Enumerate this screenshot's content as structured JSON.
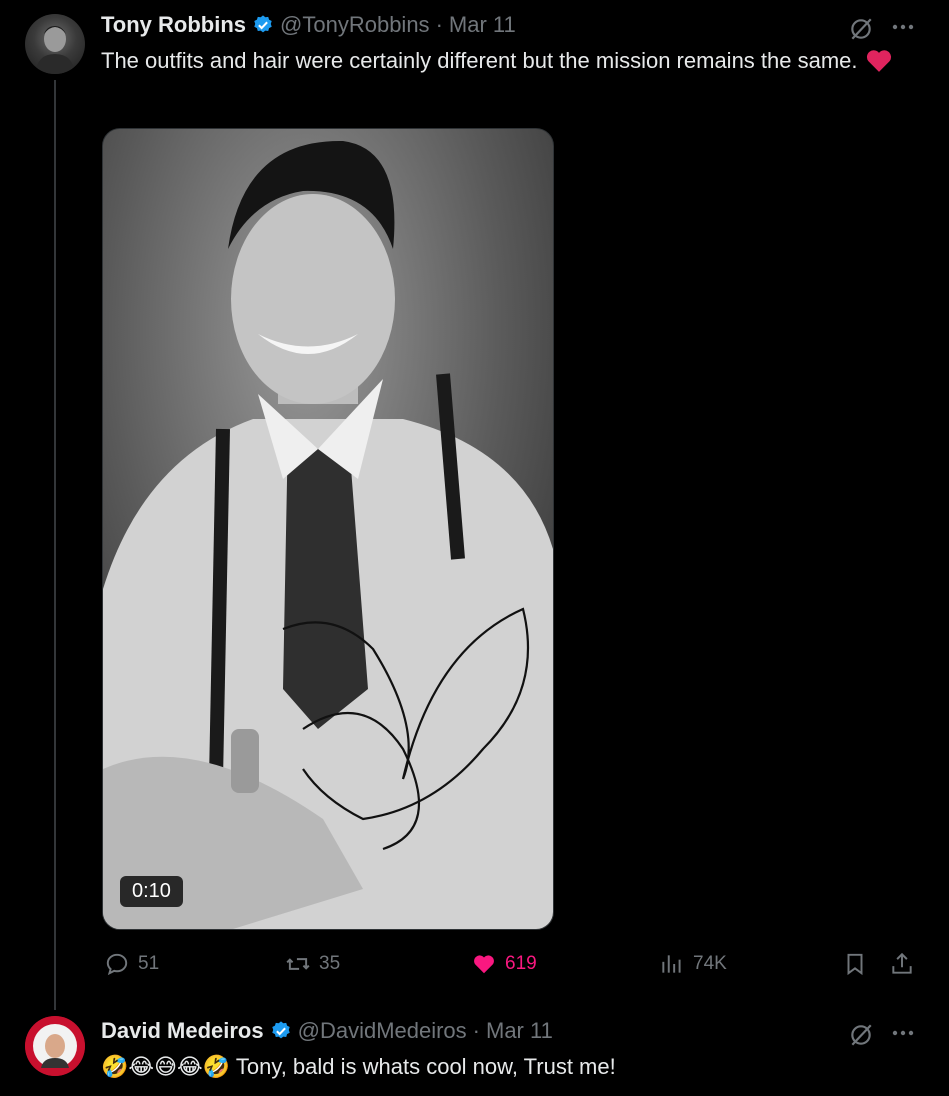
{
  "tweet": {
    "author_name": "Tony Robbins",
    "author_handle": "@TonyRobbins",
    "separator": "·",
    "date": "Mar 11",
    "text": "The outfits and hair were certainly different but the mission remains the same.",
    "video_duration": "0:10",
    "actions": {
      "replies": "51",
      "reposts": "35",
      "likes": "619",
      "views": "74K"
    },
    "liked": true,
    "icons": [
      "grok-icon",
      "more-icon",
      "reply-icon",
      "repost-icon",
      "heart-icon",
      "views-icon",
      "bookmark-icon",
      "share-icon",
      "verified-badge-icon"
    ],
    "colors": {
      "like": "#f91880",
      "verified": "#1d9bf0",
      "muted": "#71767b"
    }
  },
  "reply": {
    "author_name": "David Medeiros",
    "author_handle": "@DavidMedeiros",
    "separator": "·",
    "date": "Mar 11",
    "emojis": "🤣😂😅😂🤣",
    "text": "Tony, bald is whats cool now, Trust me!"
  }
}
